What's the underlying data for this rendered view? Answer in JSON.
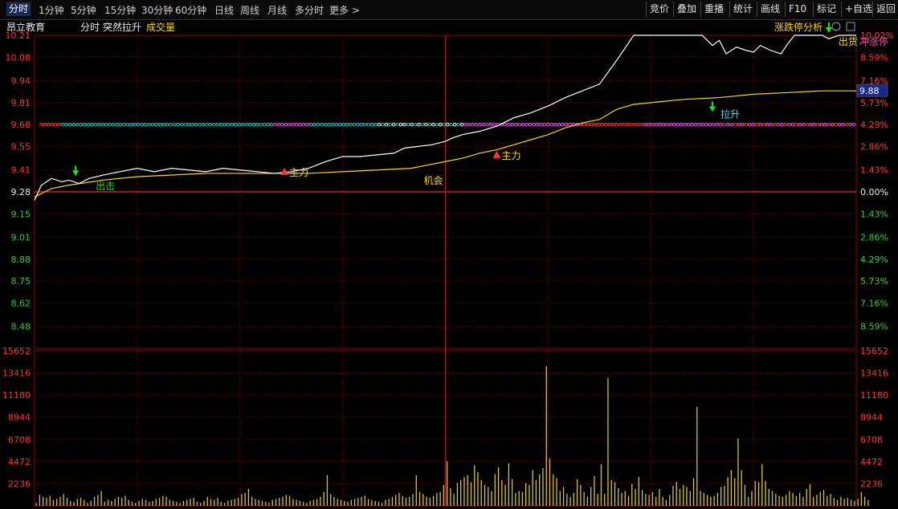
{
  "toolbar": {
    "periods": [
      "分时",
      "1分钟",
      "5分钟",
      "15分钟",
      "30分钟",
      "60分钟",
      "日线",
      "周线",
      "月线",
      "多分时",
      "更多 >"
    ],
    "active": "分时",
    "right_buttons": [
      "竞价",
      "叠加",
      "重播",
      "统计",
      "画线",
      "F10",
      "标记",
      "+自选",
      "返回"
    ]
  },
  "header": {
    "stock_name": "昂立教育",
    "view": "分时",
    "indicator": "突然拉升",
    "volume_label": "成交量",
    "analysis": "涨跌停分析"
  },
  "colors": {
    "grid": "#8b0000",
    "price_line": "#ffffff",
    "avg_line": "#ffd800",
    "up_text": "#ff3333",
    "down_text": "#33cc33",
    "volume": "#d4c24a",
    "signal_cyan": "#00d0d0",
    "signal_magenta": "#ff44ff"
  },
  "chart_data": {
    "type": "line",
    "prev_close": 9.28,
    "current_price": "9.88",
    "price_axis": [
      "10.21",
      "10.08",
      "9.94",
      "9.81",
      "9.68",
      "9.55",
      "9.41",
      "9.28",
      "9.15",
      "9.01",
      "8.88",
      "8.75",
      "8.62",
      "8.48"
    ],
    "pct_axis": [
      "10.02%",
      "8.59%",
      "7.16%",
      "5.73%",
      "4.29%",
      "2.86%",
      "1.43%",
      "0.00%",
      "1.43%",
      "2.86%",
      "4.29%",
      "5.73%",
      "7.16%",
      "8.59%"
    ],
    "volume_axis": [
      "15652",
      "13416",
      "11180",
      "8944",
      "6708",
      "4472",
      "2236"
    ],
    "ylim": [
      8.35,
      10.21
    ],
    "volume_max": 15652,
    "minutes": 240,
    "series": [
      {
        "name": "price",
        "x": [
          0,
          2,
          5,
          8,
          10,
          13,
          16,
          20,
          25,
          30,
          35,
          40,
          45,
          50,
          55,
          60,
          65,
          70,
          75,
          80,
          85,
          90,
          95,
          100,
          105,
          108,
          112,
          116,
          120,
          122,
          125,
          130,
          135,
          140,
          145,
          150,
          155,
          160,
          165,
          170,
          175,
          180,
          185,
          190,
          195,
          198,
          200,
          202,
          205,
          208,
          210,
          212,
          215,
          218,
          220,
          222,
          225,
          228,
          230,
          232,
          235,
          238,
          240
        ],
        "values": [
          9.23,
          9.32,
          9.36,
          9.34,
          9.35,
          9.33,
          9.36,
          9.38,
          9.4,
          9.42,
          9.4,
          9.42,
          9.41,
          9.4,
          9.42,
          9.41,
          9.4,
          9.39,
          9.4,
          9.42,
          9.46,
          9.49,
          9.49,
          9.5,
          9.51,
          9.54,
          9.55,
          9.56,
          9.58,
          9.6,
          9.62,
          9.64,
          9.67,
          9.72,
          9.75,
          9.79,
          9.84,
          9.88,
          9.92,
          10.06,
          10.21,
          10.21,
          10.21,
          10.21,
          10.21,
          10.15,
          10.18,
          10.1,
          10.14,
          10.12,
          10.11,
          10.15,
          10.12,
          10.1,
          10.16,
          10.21,
          10.21,
          10.21,
          10.21,
          10.19,
          10.21,
          10.21,
          10.21
        ]
      },
      {
        "name": "average",
        "x": [
          0,
          5,
          10,
          20,
          30,
          40,
          50,
          60,
          70,
          80,
          90,
          100,
          110,
          115,
          120,
          125,
          130,
          135,
          140,
          145,
          150,
          155,
          160,
          165,
          170,
          175,
          180,
          185,
          190,
          200,
          210,
          220,
          230,
          240
        ],
        "values": [
          9.25,
          9.3,
          9.32,
          9.35,
          9.37,
          9.38,
          9.39,
          9.39,
          9.39,
          9.39,
          9.4,
          9.41,
          9.42,
          9.44,
          9.46,
          9.48,
          9.51,
          9.53,
          9.56,
          9.59,
          9.62,
          9.66,
          9.69,
          9.71,
          9.77,
          9.8,
          9.81,
          9.82,
          9.83,
          9.84,
          9.86,
          9.87,
          9.88,
          9.88
        ]
      }
    ],
    "volumes": [
      300,
      1100,
      900,
      800,
      1000,
      600,
      700,
      900,
      1200,
      800,
      500,
      400,
      700,
      800,
      600,
      300,
      500,
      900,
      1100,
      1500,
      400,
      600,
      500,
      700,
      900,
      800,
      1000,
      600,
      400,
      300,
      500,
      700,
      600,
      400,
      500,
      700,
      800,
      1000,
      900,
      600,
      500,
      400,
      300,
      500,
      600,
      700,
      800,
      400,
      300,
      500,
      900,
      700,
      600,
      800,
      400,
      300,
      500,
      600,
      700,
      800,
      1200,
      1300,
      1700,
      900,
      700,
      600,
      500,
      400,
      300,
      600,
      700,
      800,
      900,
      1100,
      1000,
      700,
      600,
      500,
      400,
      300,
      500,
      600,
      700,
      900,
      1400,
      3100,
      1200,
      900,
      700,
      600,
      500,
      400,
      600,
      700,
      800,
      900,
      1000,
      700,
      600,
      500,
      400,
      300,
      600,
      700,
      900,
      1100,
      1300,
      1000,
      800,
      900,
      1200,
      3100,
      1400,
      1200,
      900,
      800,
      1000,
      1300,
      1400,
      2100,
      4500,
      1800,
      1200,
      2300,
      2600,
      2900,
      3100,
      2400,
      4100,
      3400,
      2600,
      2100,
      1900,
      1500,
      3200,
      3900,
      2600,
      2100,
      4300,
      2700,
      1300,
      1500,
      1400,
      2300,
      2100,
      3600,
      2600,
      3200,
      3800,
      14100,
      4800,
      3200,
      2800,
      1500,
      1900,
      1200,
      900,
      1300,
      2700,
      2100,
      1400,
      900,
      1900,
      3000,
      1200,
      4200,
      1200,
      12900,
      2600,
      2400,
      1800,
      1300,
      1500,
      1000,
      2200,
      1700,
      2900,
      1600,
      1200,
      1100,
      1400,
      900,
      1700,
      900,
      600,
      1100,
      2000,
      2400,
      1700,
      2100,
      1900,
      1500,
      2800,
      10000,
      1500,
      1300,
      1100,
      900,
      1000,
      1300,
      1900,
      2000,
      2900,
      3600,
      2800,
      6800,
      3600,
      2100,
      900,
      1500,
      2500,
      2400,
      4200,
      2500,
      1700,
      1500,
      1200,
      1000,
      900,
      1100,
      1500,
      1300,
      1000,
      1300,
      900,
      1700,
      2200,
      900,
      1100,
      1400,
      1600,
      1000,
      1200,
      800,
      600,
      900,
      700,
      800,
      600,
      500,
      700,
      1400,
      900,
      600
    ]
  },
  "annotations": [
    {
      "minute": 12,
      "price": 9.36,
      "text": "出击",
      "signal": "down"
    },
    {
      "minute": 73,
      "price": 9.4,
      "text": "主力",
      "signal": "up"
    },
    {
      "minute": 116,
      "price": 9.39,
      "text": "机会",
      "signal": "none"
    },
    {
      "minute": 135,
      "price": 9.5,
      "text": "主力",
      "signal": "up"
    },
    {
      "minute": 198,
      "price": 9.74,
      "text": "拉升",
      "signal": "down"
    },
    {
      "minute": 232,
      "price": 10.21,
      "text": "出货",
      "signal": "down"
    },
    {
      "minute": 232,
      "price": 10.21,
      "text": "冲涨停",
      "signal": "none"
    }
  ]
}
